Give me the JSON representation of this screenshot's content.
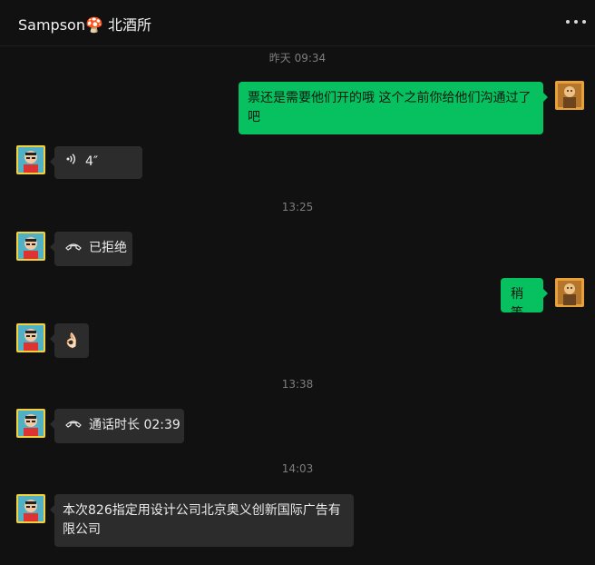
{
  "header": {
    "title": "Sampson🍄 北酒所",
    "more_icon": "more-dots-icon"
  },
  "messages": [
    {
      "kind": "timestamp",
      "text": "昨天 09:34"
    },
    {
      "kind": "text",
      "from": "me",
      "text": "票还是需要他们开的哦 这个之前你给他们沟通过了吧"
    },
    {
      "kind": "voice",
      "from": "contact",
      "duration": "4″",
      "icon": "voice-wave-icon"
    },
    {
      "kind": "timestamp",
      "text": "13:25"
    },
    {
      "kind": "call",
      "from": "contact",
      "text": "已拒绝",
      "icon": "phone-icon"
    },
    {
      "kind": "text",
      "from": "me",
      "text": "稍等"
    },
    {
      "kind": "emoji",
      "from": "contact",
      "text": "👌🏻"
    },
    {
      "kind": "timestamp",
      "text": "13:38"
    },
    {
      "kind": "call",
      "from": "contact",
      "text": "通话时长 02:39",
      "icon": "phone-icon"
    },
    {
      "kind": "timestamp",
      "text": "14:03"
    },
    {
      "kind": "text",
      "from": "contact",
      "text": "本次826指定用设计公司北京奥义创新国际广告有限公司"
    }
  ],
  "colors": {
    "background": "#111111",
    "incoming_bubble": "#2c2c2c",
    "outgoing_bubble": "#07c160",
    "timestamp": "#7d7d7d"
  }
}
